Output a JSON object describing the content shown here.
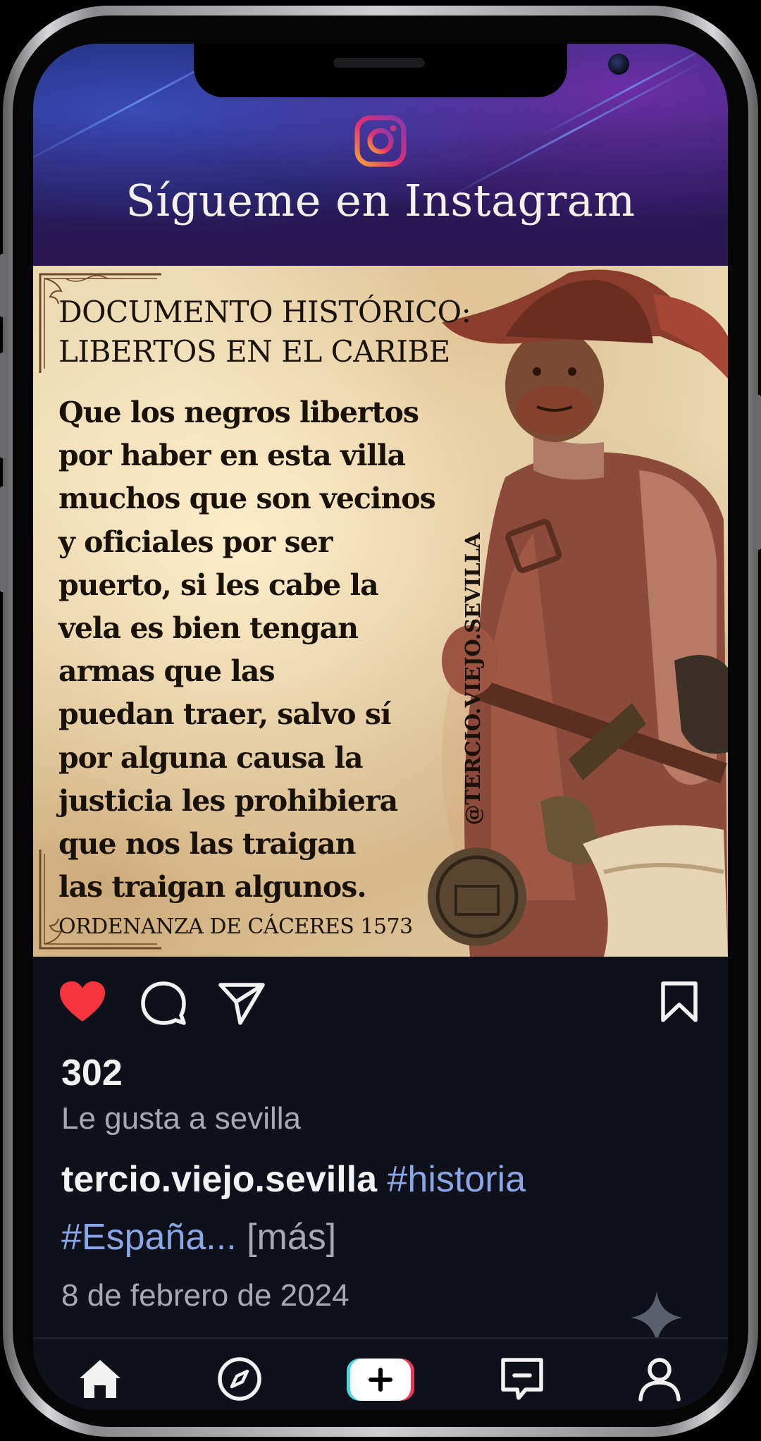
{
  "header": {
    "title": "Sígueme en Instagram"
  },
  "post": {
    "doc_title_line1": "DOCUMENTO HISTÓRICO:",
    "doc_title_line2": "LIBERTOS EN EL CARIBE",
    "body_lines": [
      "Que los negros libertos",
      "por haber en esta villa",
      "muchos que son vecinos",
      "y oficiales por ser",
      "puerto, si les cabe la",
      "vela es bien tengan",
      "armas que las",
      "puedan traer, salvo sí",
      "por alguna causa la",
      "justicia les prohibiera",
      "que nos las traigan",
      "las traigan algunos."
    ],
    "footer": "ORDENANZA DE CÁCERES 1573",
    "watermark": "@TERCIO.VIEJO.SEVILLA"
  },
  "actions": {
    "like_icon": "heart-icon",
    "comment_icon": "comment-icon",
    "share_icon": "share-icon",
    "save_icon": "bookmark-icon",
    "like_color": "#f5343e"
  },
  "stats": {
    "likes": "302",
    "liked_by": "Le gusta a sevilla"
  },
  "caption": {
    "username": "tercio.viejo.sevilla",
    "tag1": "#historia",
    "tag2": "#España...",
    "more": "[más]"
  },
  "date": "8 de febrero de 2024",
  "nav": {
    "items": [
      "home-icon",
      "explore-icon",
      "create-icon",
      "messages-icon",
      "profile-icon"
    ]
  },
  "colors": {
    "background": "#0e1119",
    "hashtag": "#8ba6e6",
    "muted": "#a7a9b0",
    "parchment": "#e9d6ae"
  }
}
